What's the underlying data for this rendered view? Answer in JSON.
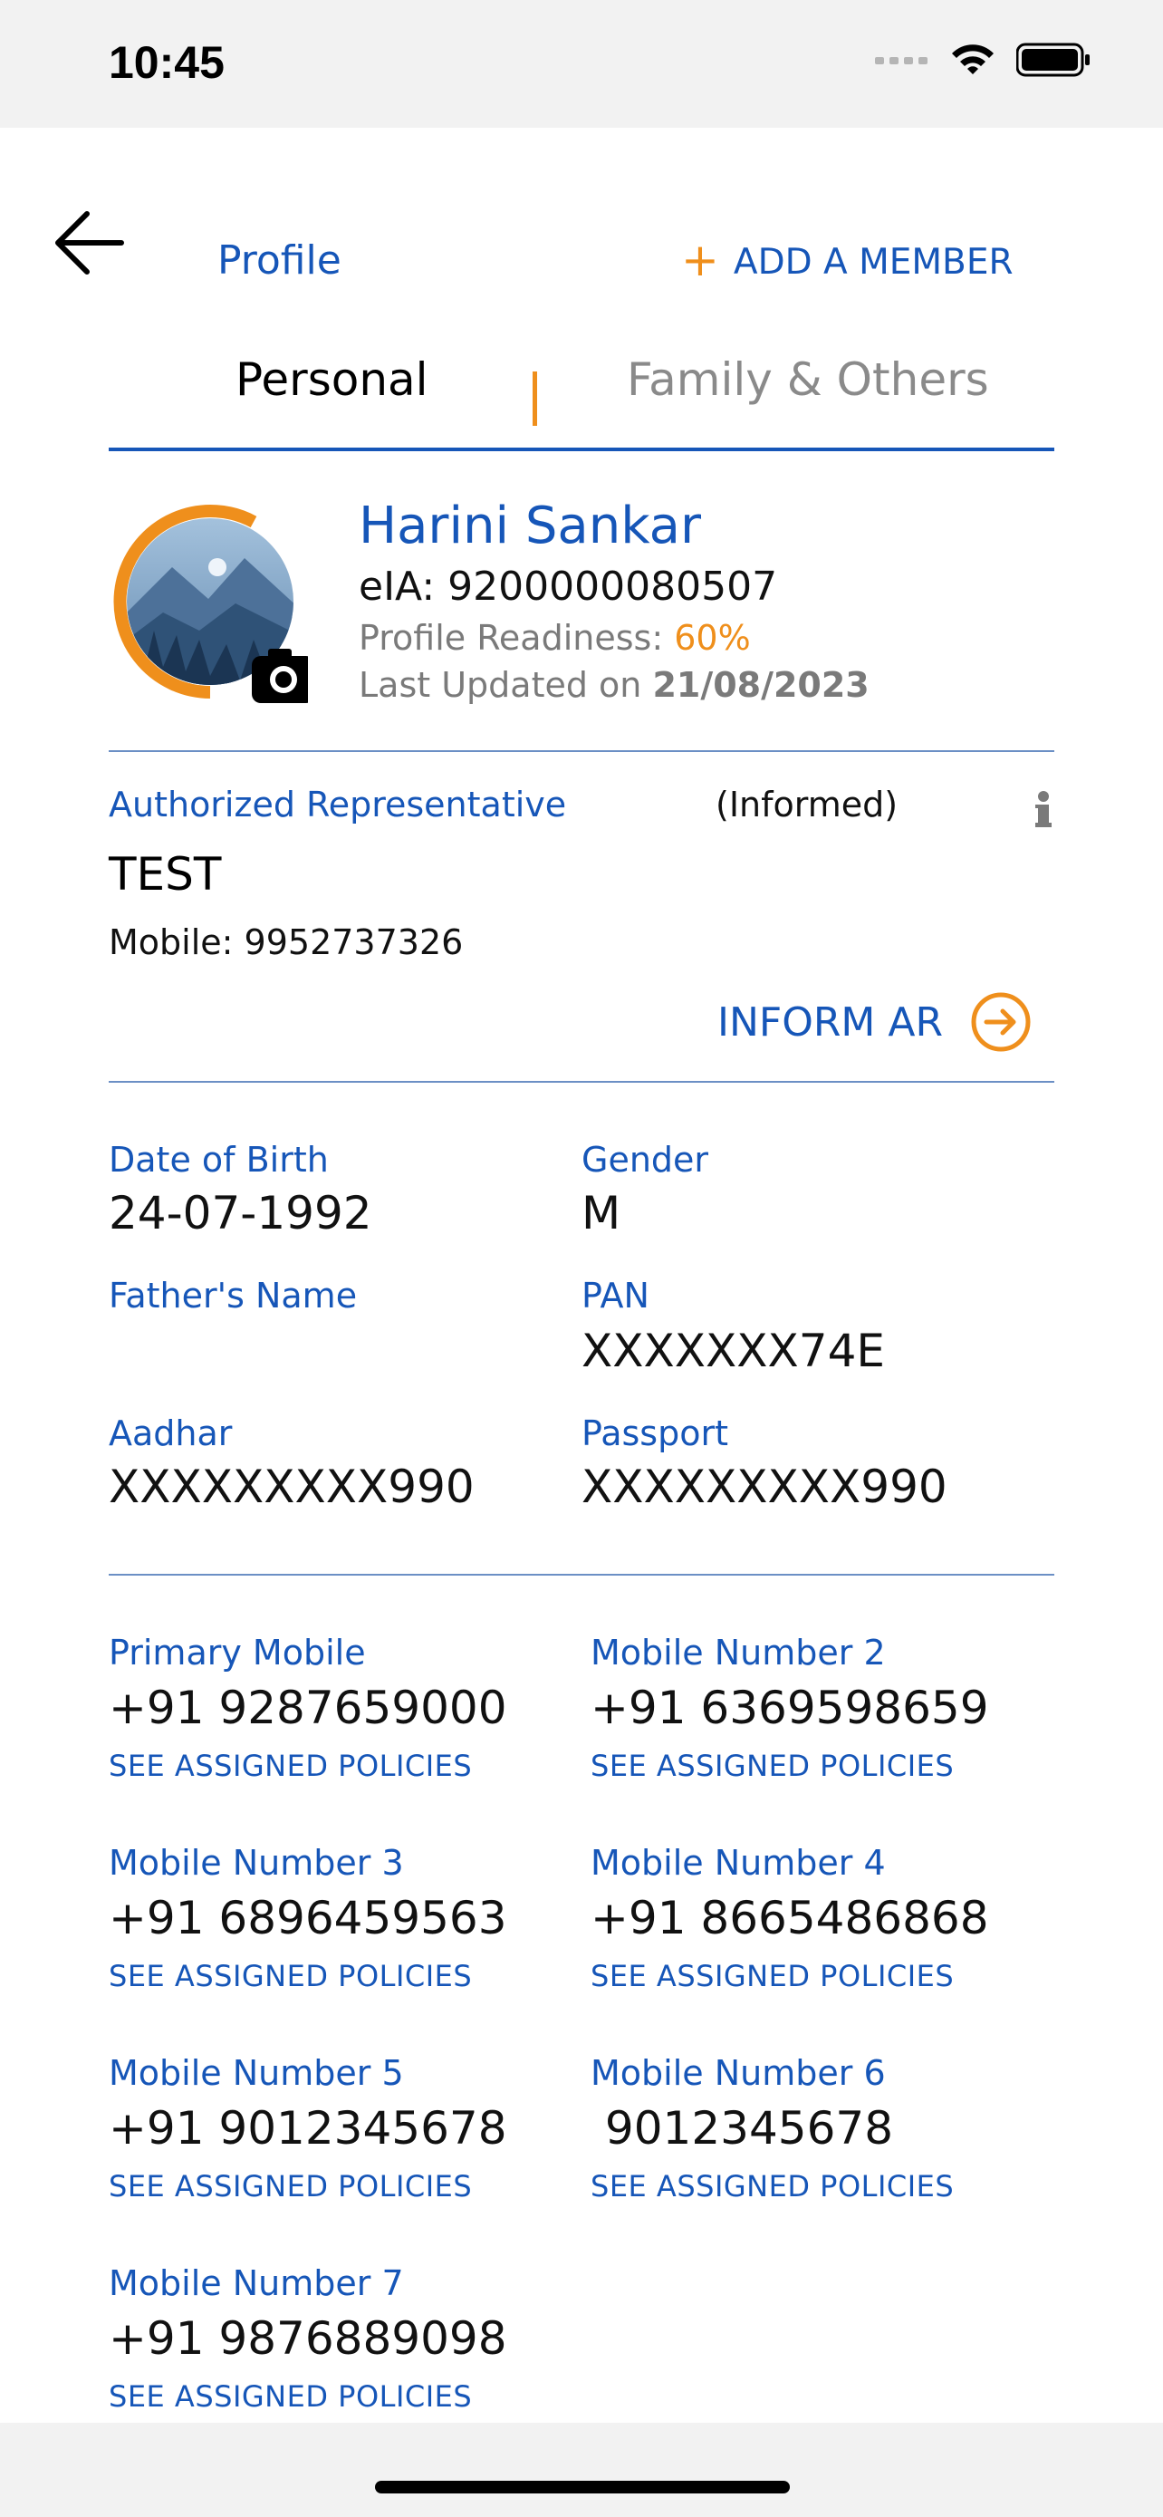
{
  "status_bar": {
    "time": "10:45"
  },
  "header": {
    "title": "Profile",
    "add_member_plus": "+",
    "add_member_label": "ADD A MEMBER"
  },
  "tabs": [
    {
      "label": "Personal",
      "active": true
    },
    {
      "label": "Family & Others",
      "active": false
    }
  ],
  "profile": {
    "name": "Harini Sankar",
    "eia": "eIA: 9200000080507",
    "readiness_label": "Profile Readiness: ",
    "readiness_value": "60%",
    "updated_label": "Last Updated on ",
    "updated_date": "21/08/2023"
  },
  "authorized_rep": {
    "title": "Authorized Representative",
    "status": "(Informed)",
    "name": "TEST",
    "mobile": "Mobile: 9952737326",
    "inform_label": "INFORM AR"
  },
  "details": {
    "dob_label": "Date of Birth",
    "dob_value": "24-07-1992",
    "gender_label": "Gender",
    "gender_value": "M",
    "father_label": "Father's Name",
    "father_value": "",
    "pan_label": "PAN",
    "pan_value": "XXXXXXX74E",
    "aadhar_label": "Aadhar",
    "aadhar_value": "XXXXXXXXX990",
    "passport_label": "Passport",
    "passport_value": "XXXXXXXXX990"
  },
  "mobiles": [
    {
      "label": "Primary Mobile",
      "value": "+91 9287659000",
      "link": "SEE ASSIGNED POLICIES"
    },
    {
      "label": "Mobile Number 2",
      "value": "+91 6369598659",
      "link": "SEE ASSIGNED POLICIES"
    },
    {
      "label": "Mobile Number 3",
      "value": "+91 6896459563",
      "link": "SEE ASSIGNED POLICIES"
    },
    {
      "label": "Mobile Number 4",
      "value": "+91 8665486868",
      "link": "SEE ASSIGNED POLICIES"
    },
    {
      "label": "Mobile Number 5",
      "value": "+91 9012345678",
      "link": "SEE ASSIGNED POLICIES"
    },
    {
      "label": "Mobile Number 6",
      "value": " 9012345678",
      "link": "SEE ASSIGNED POLICIES"
    },
    {
      "label": "Mobile Number 7",
      "value": "+91 9876889098",
      "link": "SEE ASSIGNED POLICIES"
    }
  ],
  "colors": {
    "primary": "#1656b8",
    "accent": "#ef8f1c",
    "muted": "#7a7a7a"
  },
  "icons": [
    "back-arrow-icon",
    "plus-icon",
    "camera-icon",
    "info-icon",
    "arrow-right-circle-icon",
    "wifi-icon",
    "battery-icon",
    "signal-icon"
  ]
}
